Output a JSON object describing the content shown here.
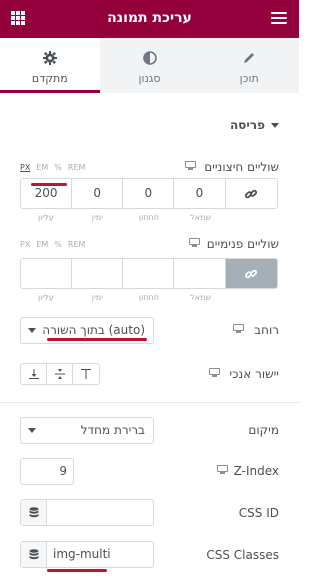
{
  "header": {
    "title": "עריכת תמונה"
  },
  "tabs": [
    {
      "label": "תוכן",
      "icon": "pencil-icon",
      "active": false
    },
    {
      "label": "סגנון",
      "icon": "contrast-icon",
      "active": false
    },
    {
      "label": "מתקדם",
      "icon": "gear-icon",
      "active": true
    }
  ],
  "section": {
    "title": "פריסה"
  },
  "margin": {
    "label": "שוליים חיצוניים",
    "units": [
      "PX",
      "EM",
      "%",
      "REM"
    ],
    "active_unit": "PX",
    "values": [
      "200",
      "0",
      "0",
      "0"
    ],
    "sides": [
      "עליון",
      "ימין",
      "תחתון",
      "שמאל"
    ]
  },
  "padding": {
    "label": "שוליים פנימיים",
    "units": [
      "PX",
      "EM",
      "%",
      "REM"
    ],
    "values": [
      "",
      "",
      "",
      ""
    ],
    "sides": [
      "עליון",
      "ימין",
      "תחתון",
      "שמאל"
    ]
  },
  "width": {
    "label": "רוחב",
    "value": "בתוך השורה (auto)"
  },
  "vertical_align": {
    "label": "יישור אנכי"
  },
  "position": {
    "label": "מיקום",
    "value": "ברירת מחדל"
  },
  "zindex": {
    "label": "Z-Index",
    "value": "9"
  },
  "css_id": {
    "label": "CSS ID",
    "value": ""
  },
  "css_classes": {
    "label": "CSS Classes",
    "value": "img-multi"
  },
  "colors": {
    "brand": "#93003c",
    "annotation": "#c8102e"
  }
}
